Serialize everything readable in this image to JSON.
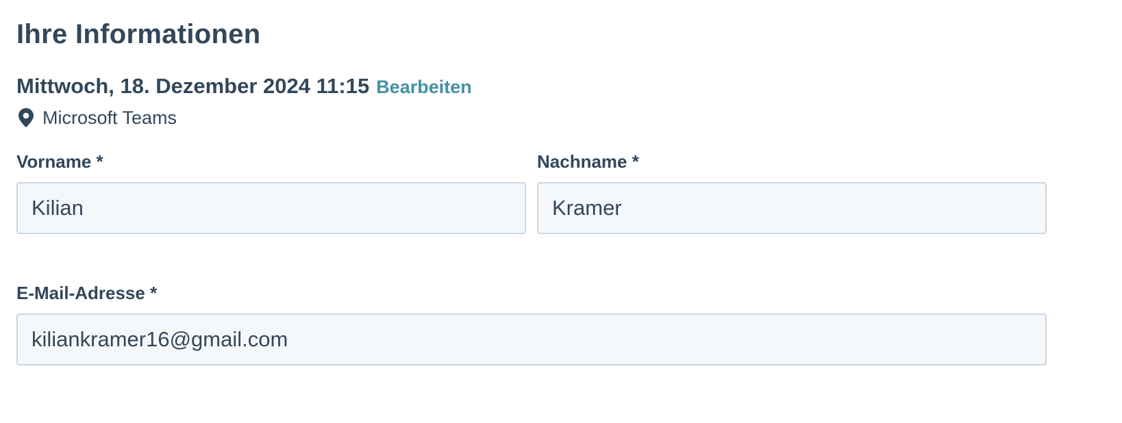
{
  "section": {
    "title": "Ihre Informationen"
  },
  "meeting": {
    "datetime": "Mittwoch, 18. Dezember 2024 11:15",
    "edit_label": "Bearbeiten",
    "location_icon": "map-pin-icon",
    "location": "Microsoft Teams"
  },
  "form": {
    "first_name": {
      "label": "Vorname *",
      "value": "Kilian"
    },
    "last_name": {
      "label": "Nachname *",
      "value": "Kramer"
    },
    "email": {
      "label": "E-Mail-Adresse *",
      "value": "kiliankramer16@gmail.com"
    }
  },
  "colors": {
    "text": "#33475b",
    "link": "#4591a6",
    "input_background": "#f5f8fa",
    "input_border": "#cbd6e2"
  }
}
